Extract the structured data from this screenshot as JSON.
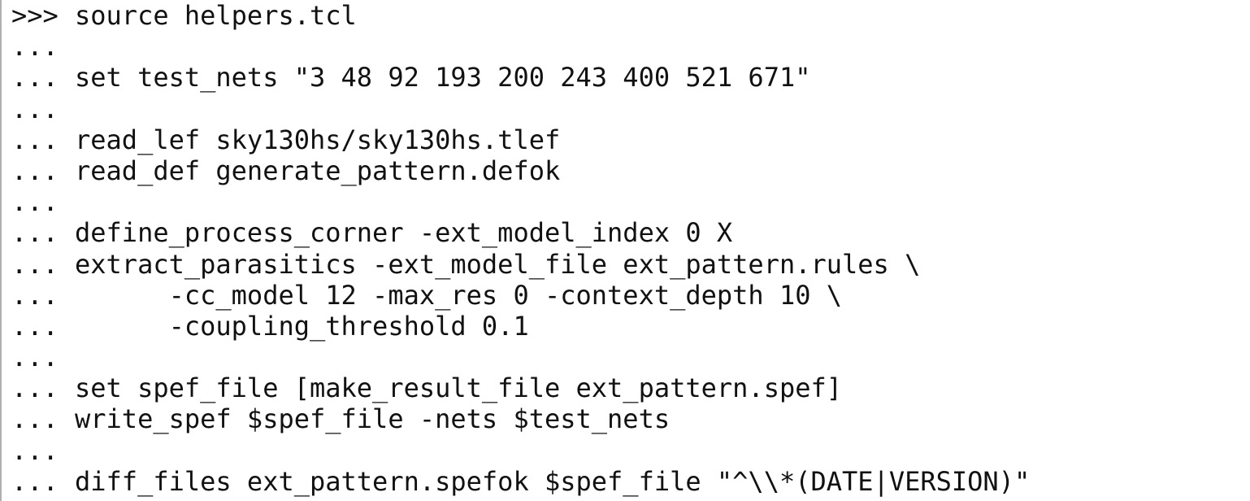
{
  "console": {
    "lines": [
      {
        "prompt": ">>>",
        "code": "source helpers.tcl"
      },
      {
        "prompt": "...",
        "code": ""
      },
      {
        "prompt": "...",
        "code": "set test_nets \"3 48 92 193 200 243 400 521 671\""
      },
      {
        "prompt": "...",
        "code": ""
      },
      {
        "prompt": "...",
        "code": "read_lef sky130hs/sky130hs.tlef"
      },
      {
        "prompt": "...",
        "code": "read_def generate_pattern.defok"
      },
      {
        "prompt": "...",
        "code": ""
      },
      {
        "prompt": "...",
        "code": "define_process_corner -ext_model_index 0 X"
      },
      {
        "prompt": "...",
        "code": "extract_parasitics -ext_model_file ext_pattern.rules \\"
      },
      {
        "prompt": "...",
        "code": "      -cc_model 12 -max_res 0 -context_depth 10 \\"
      },
      {
        "prompt": "...",
        "code": "      -coupling_threshold 0.1"
      },
      {
        "prompt": "...",
        "code": ""
      },
      {
        "prompt": "...",
        "code": "set spef_file [make_result_file ext_pattern.spef]"
      },
      {
        "prompt": "...",
        "code": "write_spef $spef_file -nets $test_nets"
      },
      {
        "prompt": "...",
        "code": ""
      },
      {
        "prompt": "...",
        "code": "diff_files ext_pattern.spefok $spef_file \"^\\\\*(DATE|VERSION)\""
      }
    ]
  },
  "colors": {
    "text": "#111111",
    "background": "#ffffff",
    "left_border": "#b0b0b0"
  }
}
